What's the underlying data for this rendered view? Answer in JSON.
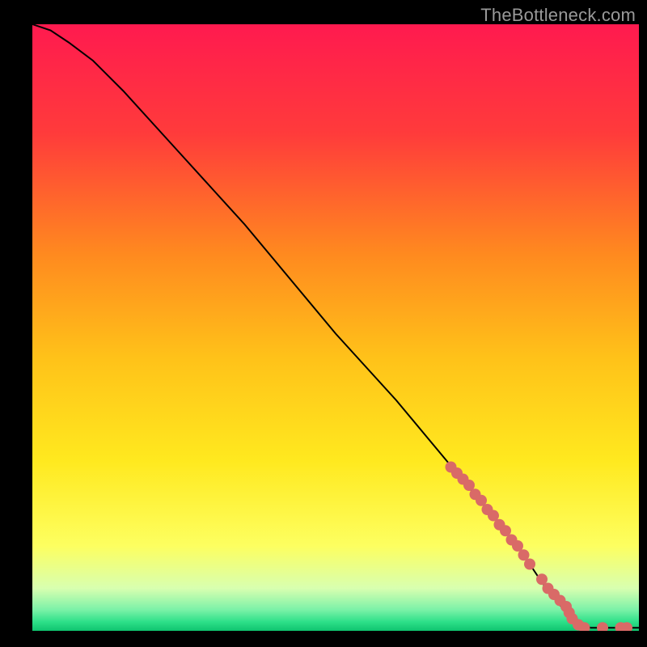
{
  "watermark": "TheBottleneck.com",
  "chart_data": {
    "type": "line",
    "title": "",
    "xlabel": "",
    "ylabel": "",
    "xlim": [
      0,
      100
    ],
    "ylim": [
      0,
      100
    ],
    "series": [
      {
        "name": "curve",
        "x": [
          0,
          3,
          6,
          10,
          15,
          20,
          25,
          30,
          35,
          40,
          45,
          50,
          55,
          60,
          65,
          70,
          75,
          80,
          84,
          88,
          92,
          95,
          100
        ],
        "y": [
          100,
          99,
          97,
          94,
          89,
          83.5,
          78,
          72.5,
          67,
          61,
          55,
          49,
          43.5,
          38,
          32,
          26,
          20,
          14,
          8,
          3,
          0.5,
          0.5,
          0.5
        ]
      }
    ],
    "markers": {
      "name": "highlight-dots",
      "x": [
        69,
        70,
        71,
        72,
        73,
        74,
        75,
        76,
        77,
        78,
        79,
        80,
        81,
        82,
        84,
        85,
        86,
        87,
        88,
        88.5,
        89,
        90,
        91,
        94,
        97,
        98
      ],
      "y": [
        27,
        26,
        25,
        24,
        22.5,
        21.5,
        20,
        19,
        17.5,
        16.5,
        15,
        14,
        12.5,
        11,
        8.5,
        7,
        6,
        5,
        4,
        3,
        2,
        1,
        0.5,
        0.5,
        0.5,
        0.5
      ]
    },
    "gradient_stops": [
      {
        "offset": 0,
        "color": "#ff1a4f"
      },
      {
        "offset": 0.18,
        "color": "#ff3b3b"
      },
      {
        "offset": 0.38,
        "color": "#ff8a1f"
      },
      {
        "offset": 0.55,
        "color": "#ffc219"
      },
      {
        "offset": 0.72,
        "color": "#ffe91f"
      },
      {
        "offset": 0.86,
        "color": "#fdff60"
      },
      {
        "offset": 0.93,
        "color": "#d8ffb0"
      },
      {
        "offset": 0.965,
        "color": "#7cf2a8"
      },
      {
        "offset": 0.985,
        "color": "#2ee089"
      },
      {
        "offset": 1.0,
        "color": "#0fc46f"
      }
    ],
    "marker_color": "#d96a67",
    "curve_color": "#000000"
  }
}
